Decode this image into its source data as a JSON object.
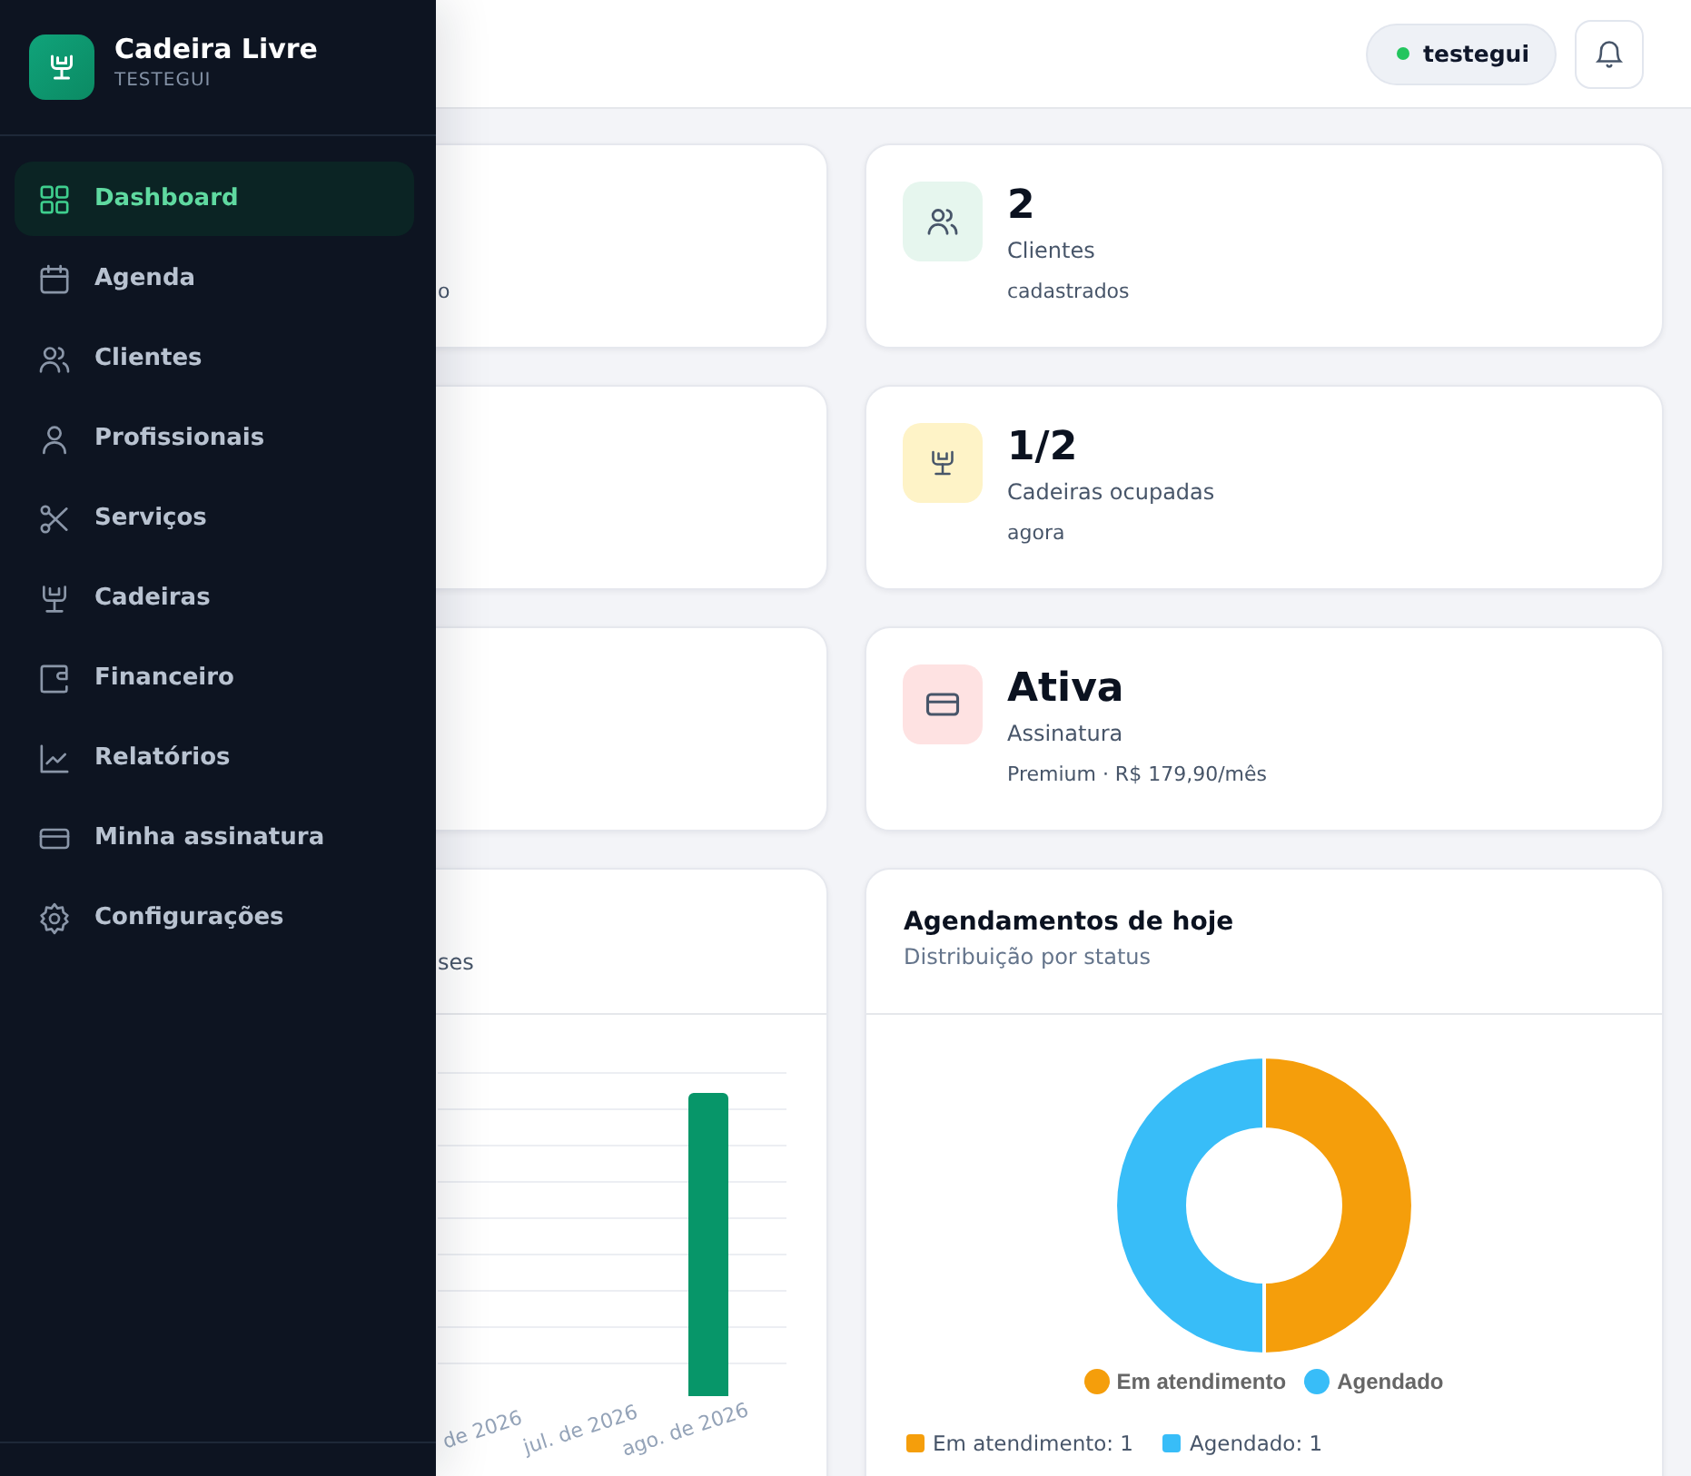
{
  "sidebar": {
    "brand": {
      "title": "Cadeira Livre",
      "subtitle": "TESTEGUI"
    },
    "items": [
      {
        "label": "Dashboard",
        "selected": true
      },
      {
        "label": "Agenda",
        "selected": false
      },
      {
        "label": "Clientes",
        "selected": false
      },
      {
        "label": "Profissionais",
        "selected": false
      },
      {
        "label": "Serviços",
        "selected": false
      },
      {
        "label": "Cadeiras",
        "selected": false
      },
      {
        "label": "Financeiro",
        "selected": false
      },
      {
        "label": "Relatórios",
        "selected": false
      },
      {
        "label": "Minha assinatura",
        "selected": false
      },
      {
        "label": "Configurações",
        "selected": false
      }
    ]
  },
  "header": {
    "user": "testegui"
  },
  "left_cards": [
    {
      "fragment": "o"
    }
  ],
  "stat_cards": [
    {
      "value": "2",
      "label": "Clientes",
      "note": "cadastrados",
      "color": "#e6f6ee"
    },
    {
      "value": "1/2",
      "label": "Cadeiras ocupadas",
      "note": "agora",
      "color": "#fef3c7"
    },
    {
      "value": "Ativa",
      "label": "Assinatura",
      "note": "Premium · R$ 179,90/mês",
      "color": "#fee2e2"
    }
  ],
  "bar_card": {
    "subtitle_fragment": "ses",
    "x_labels": [
      "de 2026",
      "jul. de 2026",
      "ago. de 2026"
    ]
  },
  "donut_card": {
    "title": "Agendamentos de hoje",
    "subtitle": "Distribuição por status",
    "chart_data": {
      "type": "donut",
      "categories": [
        "Em atendimento",
        "Agendado"
      ],
      "values": [
        50,
        50
      ]
    },
    "legend": [
      {
        "color": "#f59e0b"
      },
      {
        "color": "#38bdf8"
      }
    ],
    "summary": [
      {
        "label": "Em atendimento: 1",
        "color": "#f59e0b"
      },
      {
        "label": "Agendado: 1",
        "color": "#38bdf8"
      }
    ]
  }
}
